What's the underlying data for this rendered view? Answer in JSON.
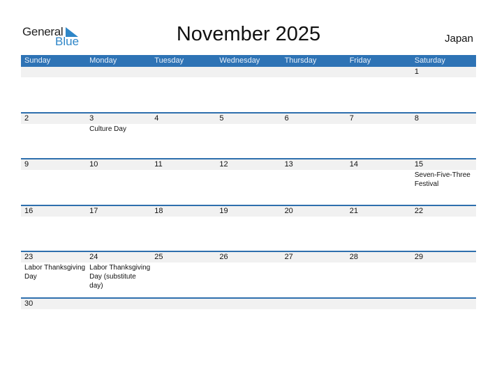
{
  "logo": {
    "line1": "General",
    "line2": "Blue"
  },
  "title": "November 2025",
  "country": "Japan",
  "weekdays": [
    "Sunday",
    "Monday",
    "Tuesday",
    "Wednesday",
    "Thursday",
    "Friday",
    "Saturday"
  ],
  "weeks": [
    [
      {
        "d": ""
      },
      {
        "d": ""
      },
      {
        "d": ""
      },
      {
        "d": ""
      },
      {
        "d": ""
      },
      {
        "d": ""
      },
      {
        "d": "1"
      }
    ],
    [
      {
        "d": "2"
      },
      {
        "d": "3",
        "h": "Culture Day"
      },
      {
        "d": "4"
      },
      {
        "d": "5"
      },
      {
        "d": "6"
      },
      {
        "d": "7"
      },
      {
        "d": "8"
      }
    ],
    [
      {
        "d": "9"
      },
      {
        "d": "10"
      },
      {
        "d": "11"
      },
      {
        "d": "12"
      },
      {
        "d": "13"
      },
      {
        "d": "14"
      },
      {
        "d": "15",
        "h": "Seven-Five-Three Festival"
      }
    ],
    [
      {
        "d": "16"
      },
      {
        "d": "17"
      },
      {
        "d": "18"
      },
      {
        "d": "19"
      },
      {
        "d": "20"
      },
      {
        "d": "21"
      },
      {
        "d": "22"
      }
    ],
    [
      {
        "d": "23",
        "h": "Labor Thanksgiving Day"
      },
      {
        "d": "24",
        "h": "Labor Thanksgiving Day (substitute day)"
      },
      {
        "d": "25"
      },
      {
        "d": "26"
      },
      {
        "d": "27"
      },
      {
        "d": "28"
      },
      {
        "d": "29"
      }
    ],
    [
      {
        "d": "30"
      },
      {
        "d": ""
      },
      {
        "d": ""
      },
      {
        "d": ""
      },
      {
        "d": ""
      },
      {
        "d": ""
      },
      {
        "d": ""
      }
    ]
  ]
}
